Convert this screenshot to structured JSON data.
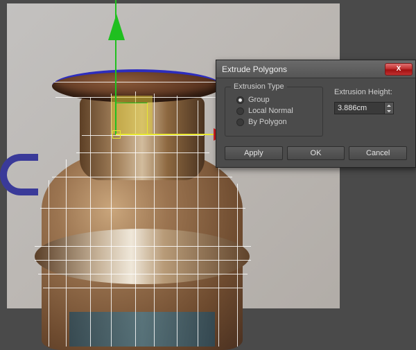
{
  "dialog": {
    "title": "Extrude Polygons",
    "extrusion_type": {
      "legend": "Extrusion Type",
      "options": [
        "Group",
        "Local Normal",
        "By Polygon"
      ],
      "selected": "Group"
    },
    "height_label": "Extrusion Height:",
    "height_value": "3.886cm",
    "buttons": {
      "apply": "Apply",
      "ok": "OK",
      "cancel": "Cancel"
    }
  },
  "icons": {
    "close": "X"
  }
}
